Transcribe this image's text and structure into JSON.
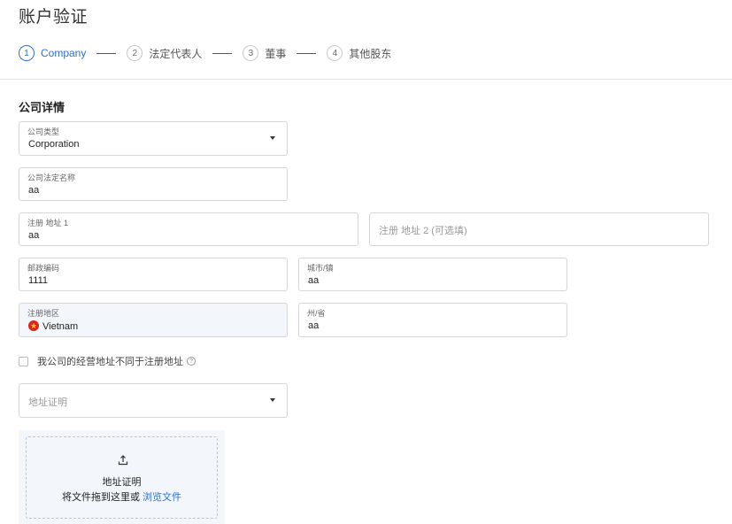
{
  "page": {
    "title": "账户验证"
  },
  "stepper": {
    "steps": [
      {
        "num": "1",
        "label": "Company"
      },
      {
        "num": "2",
        "label": "法定代表人"
      },
      {
        "num": "3",
        "label": "董事"
      },
      {
        "num": "4",
        "label": "其他股东"
      }
    ]
  },
  "section": {
    "title": "公司详情"
  },
  "form": {
    "company_type": {
      "label": "公司类型",
      "value": "Corporation"
    },
    "legal_name": {
      "label": "公司法定名称",
      "value": "aa"
    },
    "address1": {
      "label": "注册 地址 1",
      "value": "aa"
    },
    "address2": {
      "placeholder": "注册 地址 2 (可选填)"
    },
    "postal_code": {
      "label": "邮政编码",
      "value": "1111"
    },
    "city": {
      "label": "城市/镇",
      "value": "aa"
    },
    "region": {
      "label": "注册地区",
      "value": "Vietnam"
    },
    "state": {
      "label": "州/省",
      "value": "aa"
    },
    "different_address": {
      "label": "我公司的经营地址不同于注册地址",
      "checked": false
    },
    "address_proof": {
      "placeholder": "地址证明"
    }
  },
  "upload": {
    "title": "地址证明",
    "hint": "将文件拖到这里或",
    "browse": "浏览文件"
  },
  "colors": {
    "accent": "#2f6fd1",
    "border": "#d6d6d6",
    "filled_bg": "#f3f6fa"
  }
}
